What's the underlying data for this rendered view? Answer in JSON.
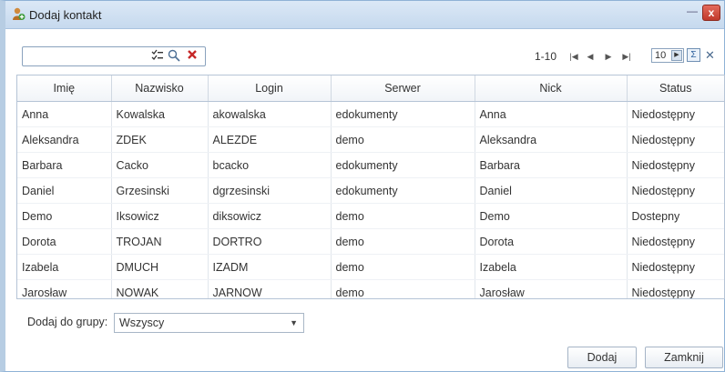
{
  "window": {
    "title": "Dodaj kontakt",
    "minimize": "—",
    "close": "x"
  },
  "search": {
    "value": "",
    "placeholder": ""
  },
  "pager": {
    "range": "1-10",
    "page_size": "10"
  },
  "table": {
    "headers": [
      "Imię",
      "Nazwisko",
      "Login",
      "Serwer",
      "Nick",
      "Status"
    ],
    "rows": [
      [
        "Anna",
        "Kowalska",
        "akowalska",
        "edokumenty",
        "Anna",
        "Niedostępny"
      ],
      [
        "Aleksandra",
        "ZDEK",
        "ALEZDE",
        "demo",
        "Aleksandra",
        "Niedostępny"
      ],
      [
        "Barbara",
        "Cacko",
        "bcacko",
        "edokumenty",
        "Barbara",
        "Niedostępny"
      ],
      [
        "Daniel",
        "Grzesinski",
        "dgrzesinski",
        "edokumenty",
        "Daniel",
        "Niedostępny"
      ],
      [
        "Demo",
        "Iksowicz",
        "diksowicz",
        "demo",
        "Demo",
        "Dostepny"
      ],
      [
        "Dorota",
        "TROJAN",
        "DORTRO",
        "demo",
        "Dorota",
        "Niedostępny"
      ],
      [
        "Izabela",
        "DMUCH",
        "IZADM",
        "demo",
        "Izabela",
        "Niedostępny"
      ],
      [
        "Jarosław",
        "NOWAK",
        "JARNOW",
        "demo",
        "Jarosław",
        "Niedostępny"
      ]
    ]
  },
  "footer": {
    "group_label": "Dodaj do grupy:",
    "group_value": "Wszyscy",
    "add_label": "Dodaj",
    "close_label": "Zamknij"
  },
  "colors": {
    "titlebar": "#c6d9ee",
    "close_button": "#c0392b",
    "border": "#8fb2d6"
  }
}
